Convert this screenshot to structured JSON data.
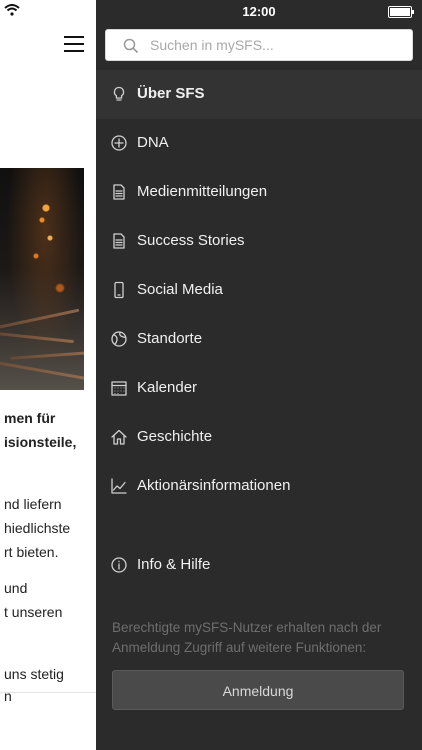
{
  "status_bar": {
    "time": "12:00"
  },
  "background_page": {
    "lines": [
      {
        "text": "men für",
        "bold": true
      },
      {
        "text": "isionsteile,",
        "bold": true
      },
      {
        "text": "nd liefern",
        "bold": false
      },
      {
        "text": "hiedlichste",
        "bold": false
      },
      {
        "text": "rt bieten.",
        "bold": false
      },
      {
        "text": "und",
        "bold": false
      },
      {
        "text": "t unseren",
        "bold": false
      },
      {
        "text": "uns stetig",
        "bold": false
      },
      {
        "text": "n",
        "bold": false
      }
    ]
  },
  "search": {
    "placeholder": "Suchen in mySFS..."
  },
  "menu": {
    "items": [
      {
        "label": "Über SFS",
        "icon": "lightbulb-icon",
        "active": true
      },
      {
        "label": "DNA",
        "icon": "plus-circle-icon"
      },
      {
        "label": "Medienmitteilungen",
        "icon": "document-icon"
      },
      {
        "label": "Success Stories",
        "icon": "document-icon"
      },
      {
        "label": "Social Media",
        "icon": "smartphone-icon"
      },
      {
        "label": "Standorte",
        "icon": "globe-icon"
      },
      {
        "label": "Kalender",
        "icon": "calendar-icon"
      },
      {
        "label": "Geschichte",
        "icon": "house-icon"
      },
      {
        "label": "Aktionärsinformationen",
        "icon": "chart-icon"
      },
      {
        "label": "Info & Hilfe",
        "icon": "info-icon"
      }
    ]
  },
  "login": {
    "note": "Berechtigte mySFS-Nutzer erhalten nach der Anmeldung Zugriff auf weitere Funktionen:",
    "button_label": "Anmeldung"
  },
  "colors": {
    "drawer_bg": "#2b2b2b",
    "active_item_bg": "#333333",
    "button_bg": "#4a4a4a",
    "note_text": "#6e6e6e"
  }
}
